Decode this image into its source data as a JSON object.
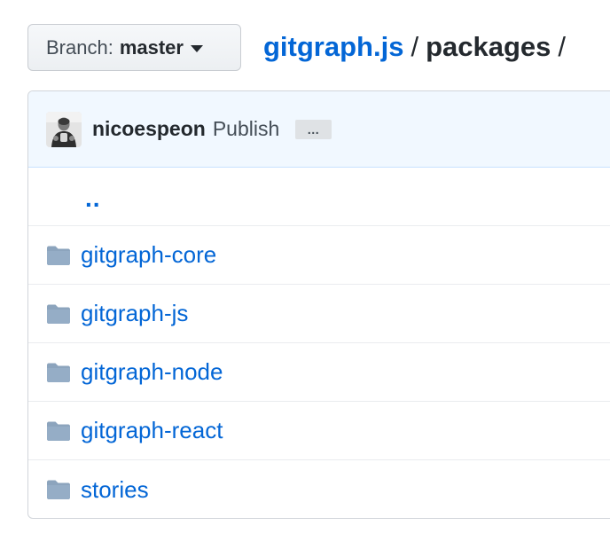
{
  "branch": {
    "prefix": "Branch:",
    "name": "master"
  },
  "breadcrumb": {
    "repo": "gitgraph.js",
    "separator": "/",
    "current": "packages",
    "trailing": "/"
  },
  "commit": {
    "author": "nicoespeon",
    "message": "Publish",
    "ellipsis": "…"
  },
  "files": {
    "parent_link": "..",
    "items": [
      {
        "name": "gitgraph-core",
        "type": "folder",
        "icon": "folder-icon"
      },
      {
        "name": "gitgraph-js",
        "type": "folder",
        "icon": "folder-icon"
      },
      {
        "name": "gitgraph-node",
        "type": "folder",
        "icon": "folder-icon"
      },
      {
        "name": "gitgraph-react",
        "type": "folder",
        "icon": "folder-icon"
      },
      {
        "name": "stories",
        "type": "folder",
        "icon": "folder-icon"
      }
    ]
  },
  "colors": {
    "link": "#0366d6",
    "text": "#24292e",
    "folder": "#79b8ff",
    "commit_bar_bg": "#f1f8ff"
  }
}
